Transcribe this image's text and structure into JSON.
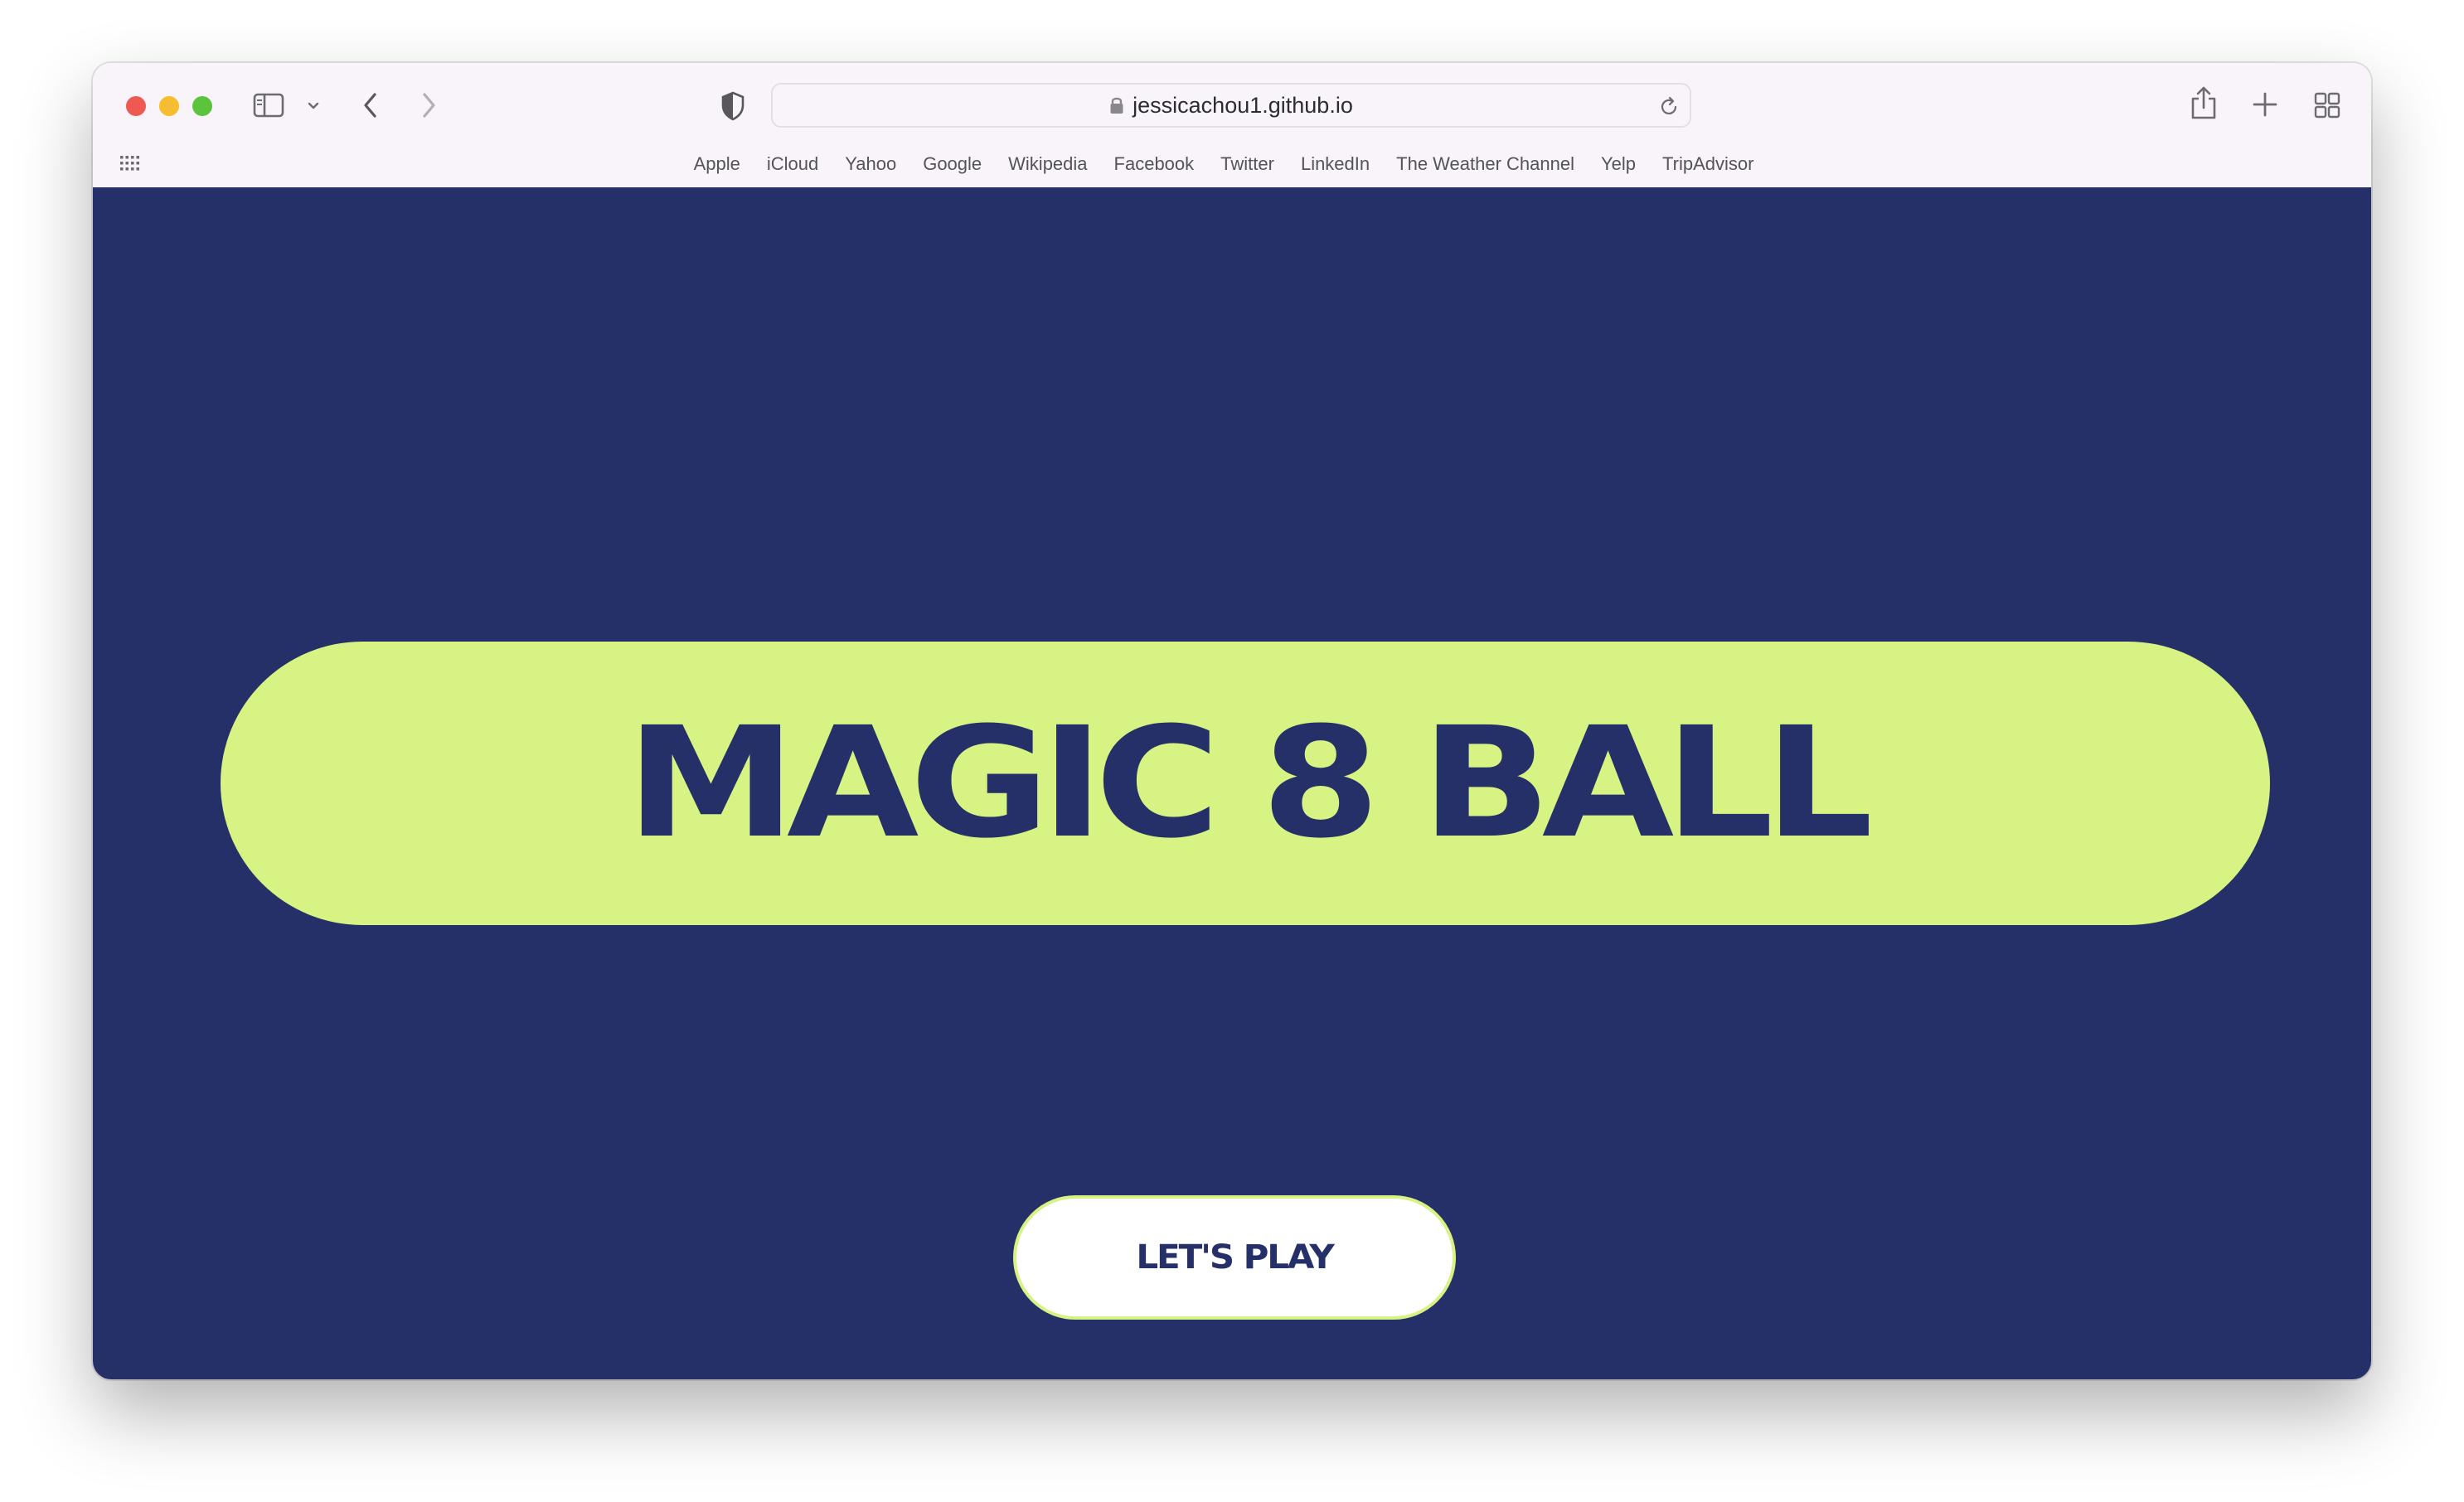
{
  "browser": {
    "url": "jessicachou1.github.io",
    "favorites": [
      "Apple",
      "iCloud",
      "Yahoo",
      "Google",
      "Wikipedia",
      "Facebook",
      "Twitter",
      "LinkedIn",
      "The Weather Channel",
      "Yelp",
      "TripAdvisor"
    ],
    "icons": {
      "sidebar": "sidebar-icon",
      "back": "chevron-left-icon",
      "forward": "chevron-right-icon",
      "shield": "shield-icon",
      "lock": "lock-icon",
      "reload": "reload-icon",
      "share": "share-icon",
      "new_tab": "plus-icon",
      "tab_overview": "tab-overview-icon",
      "grid": "apps-grid-icon"
    },
    "traffic_light_colors": {
      "close": "#ee5a52",
      "minimize": "#f5bd2f",
      "zoom": "#5bc43c"
    }
  },
  "page": {
    "title": "MAGIC 8 BALL",
    "button_label": "LET'S PLAY",
    "colors": {
      "background": "#253068",
      "accent": "#d7f383",
      "button_background": "#ffffff"
    }
  }
}
